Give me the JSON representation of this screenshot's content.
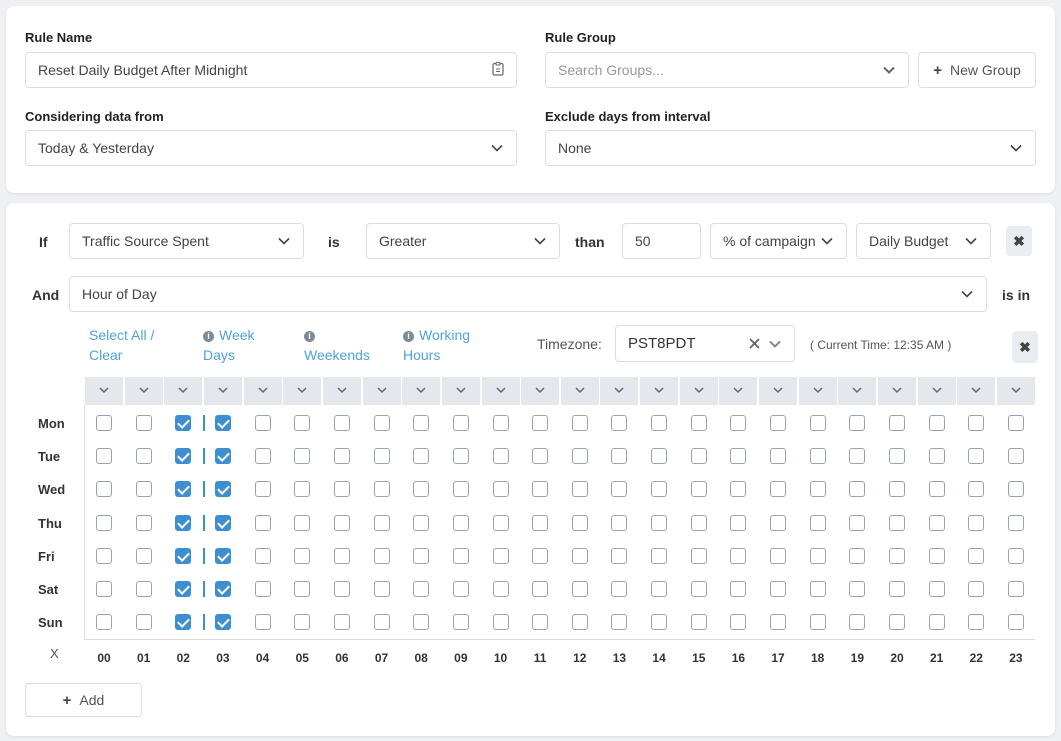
{
  "rule_name": {
    "label": "Rule Name",
    "value": "Reset Daily Budget After Midnight"
  },
  "rule_group": {
    "label": "Rule Group",
    "placeholder": "Search Groups...",
    "new_group_label": "New Group"
  },
  "considering": {
    "label": "Considering data from",
    "value": "Today & Yesterday"
  },
  "exclude_days": {
    "label": "Exclude days from interval",
    "value": "None"
  },
  "condition1": {
    "if_label": "If",
    "metric": "Traffic Source Spent",
    "is_label": "is",
    "operator": "Greater",
    "than_label": "than",
    "value": "50",
    "unit": "% of campaign",
    "target": "Daily Budget",
    "remove_label": "✖"
  },
  "condition2": {
    "and_label": "And",
    "metric": "Hour of Day",
    "is_in_label": "is in"
  },
  "schedule": {
    "select_all": "Select All /",
    "clear": "Clear",
    "week_days_1": "Week",
    "week_days_2": "Days",
    "weekends": "Weekends",
    "working_1": "Working",
    "working_2": "Hours",
    "timezone_label": "Timezone:",
    "timezone_value": "PST8PDT",
    "current_time": "( Current Time: 12:35 AM )",
    "remove_label": "✖",
    "corner_label": "X",
    "days": [
      "Mon",
      "Tue",
      "Wed",
      "Thu",
      "Fri",
      "Sat",
      "Sun"
    ],
    "hours": [
      "00",
      "01",
      "02",
      "03",
      "04",
      "05",
      "06",
      "07",
      "08",
      "09",
      "10",
      "11",
      "12",
      "13",
      "14",
      "15",
      "16",
      "17",
      "18",
      "19",
      "20",
      "21",
      "22",
      "23"
    ],
    "checked_hours": [
      2,
      3
    ]
  },
  "add_label": "Add",
  "icons": {
    "chevron": "chevron-down-icon",
    "plus": "plus-icon",
    "info": "info-icon",
    "close": "close-icon",
    "clipboard": "clipboard-icon"
  },
  "colors": {
    "accent": "#3d8fd1",
    "link": "#4ea3d8"
  }
}
